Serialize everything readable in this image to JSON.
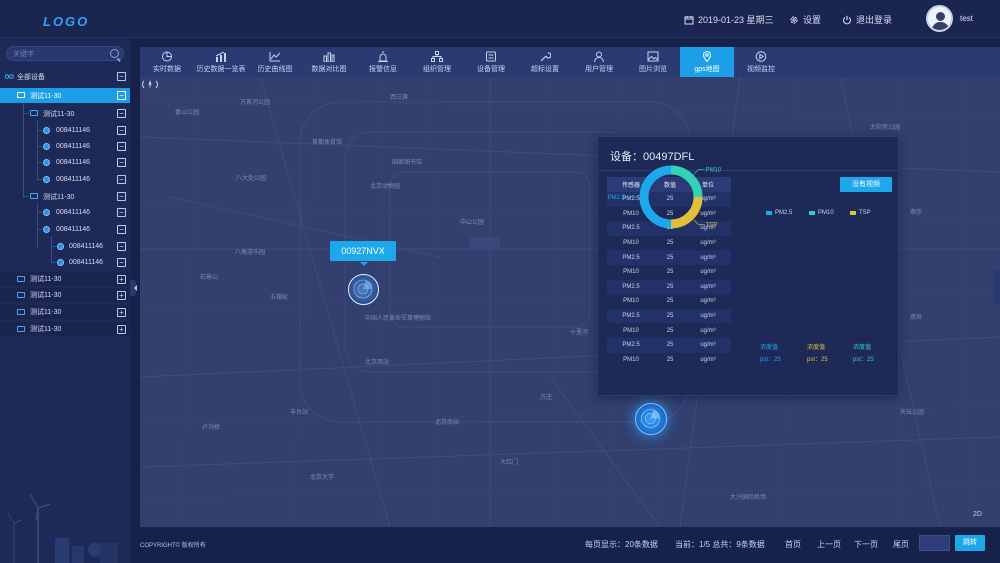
{
  "header": {
    "logo": "LOGO",
    "date": "2019-01-23 星期三",
    "settings_label": "设置",
    "logout_label": "退出登录",
    "username": "test"
  },
  "sidebar": {
    "search_placeholder": "关键字",
    "items": [
      {
        "label": "全部设备",
        "btn": "−"
      },
      {
        "label": "测试11-30",
        "btn": "−"
      },
      {
        "label": "测试11-30",
        "btn": "−"
      },
      {
        "label": "008411146",
        "btn": "−"
      },
      {
        "label": "008411146",
        "btn": "−"
      },
      {
        "label": "008411146",
        "btn": "−"
      },
      {
        "label": "008411146",
        "btn": "−"
      },
      {
        "label": "测试11-30",
        "btn": "−"
      },
      {
        "label": "008411146",
        "btn": "−"
      },
      {
        "label": "008411146",
        "btn": "−"
      },
      {
        "label": "008411146",
        "btn": "−"
      },
      {
        "label": "008411146",
        "btn": "−"
      },
      {
        "label": "测试11-30",
        "btn": "+"
      },
      {
        "label": "测试11-30",
        "btn": "+"
      },
      {
        "label": "测试11-30",
        "btn": "+"
      },
      {
        "label": "测试11-30",
        "btn": "+"
      }
    ]
  },
  "tabs": [
    {
      "label": "实时数据",
      "icon": "clock-pie-icon"
    },
    {
      "label": "历史数据一览表",
      "icon": "bar-line-icon"
    },
    {
      "label": "历史曲线图",
      "icon": "line-chart-icon"
    },
    {
      "label": "数据对比图",
      "icon": "bar-chart-icon"
    },
    {
      "label": "报警信息",
      "icon": "alarm-icon"
    },
    {
      "label": "组织管理",
      "icon": "org-icon"
    },
    {
      "label": "设备管理",
      "icon": "device-icon"
    },
    {
      "label": "超标设置",
      "icon": "wrench-icon"
    },
    {
      "label": "用户管理",
      "icon": "user-icon"
    },
    {
      "label": "图片浏览",
      "icon": "image-icon"
    },
    {
      "label": "gps地图",
      "icon": "location-pin-icon"
    },
    {
      "label": "视频监控",
      "icon": "play-icon"
    }
  ],
  "active_tab": "gps地图",
  "map": {
    "marker_label": "00927NVX",
    "place_labels": [
      "香山公园",
      "八大处公园",
      "首都体育馆",
      "北京动物园",
      "国家图书馆",
      "中国人民革命军事博物馆",
      "卢沟桥",
      "北京西站",
      "万泉河公园",
      "太阳宫公园",
      "大兴国际机场",
      "丰台站",
      "北京南站",
      "大红门",
      "十里河",
      "中山公园",
      "燕莎",
      "双井",
      "石景山",
      "八角游乐园",
      "五棵松",
      "方庄",
      "西三旗",
      "北京大学",
      "天坛公园"
    ]
  },
  "panel": {
    "title": "设备：00497DFL",
    "video_button": "没有视频",
    "table_headers": [
      "传感器",
      "数值",
      "单位"
    ],
    "table_rows": [
      [
        "PM2.5",
        "25",
        "ug/m³"
      ],
      [
        "PM10",
        "25",
        "ug/m³"
      ],
      [
        "PM2.5",
        "25",
        "ug/m³"
      ],
      [
        "PM10",
        "25",
        "ug/m³"
      ],
      [
        "PM2.5",
        "25",
        "ug/m³"
      ],
      [
        "PM10",
        "25",
        "ug/m³"
      ],
      [
        "PM2.5",
        "25",
        "ug/m³"
      ],
      [
        "PM10",
        "25",
        "ug/m³"
      ],
      [
        "PM2.5",
        "25",
        "ug/m³"
      ],
      [
        "PM10",
        "25",
        "ug/m³"
      ],
      [
        "PM2.5",
        "25",
        "ug/m³"
      ],
      [
        "PM10",
        "25",
        "ug/m³"
      ]
    ],
    "stats": [
      {
        "key": "浓度值",
        "value": "pst：25",
        "color": "#1ea8ec"
      },
      {
        "key": "浓度值",
        "value": "pst：25",
        "color": "#e0c03a"
      },
      {
        "key": "浓度值",
        "value": "pst：25",
        "color": "#33d1b5"
      }
    ]
  },
  "chart_data": {
    "type": "pie",
    "labels": [
      "PM2.5",
      "PM10",
      "TSP"
    ],
    "values": [
      50,
      25,
      25
    ],
    "colors": [
      "#1ea8ec",
      "#33d1b5",
      "#e0c03a"
    ],
    "legend_position": "top"
  },
  "footer": {
    "copyright": "COPYRIGHT© 版权所有",
    "per_page": "每页显示：20条数据",
    "current": "当前：1/5  总共：9条数据",
    "first": "首页",
    "prev": "上一页",
    "next": "下一页",
    "last": "尾页",
    "goto_label": "跳转"
  }
}
